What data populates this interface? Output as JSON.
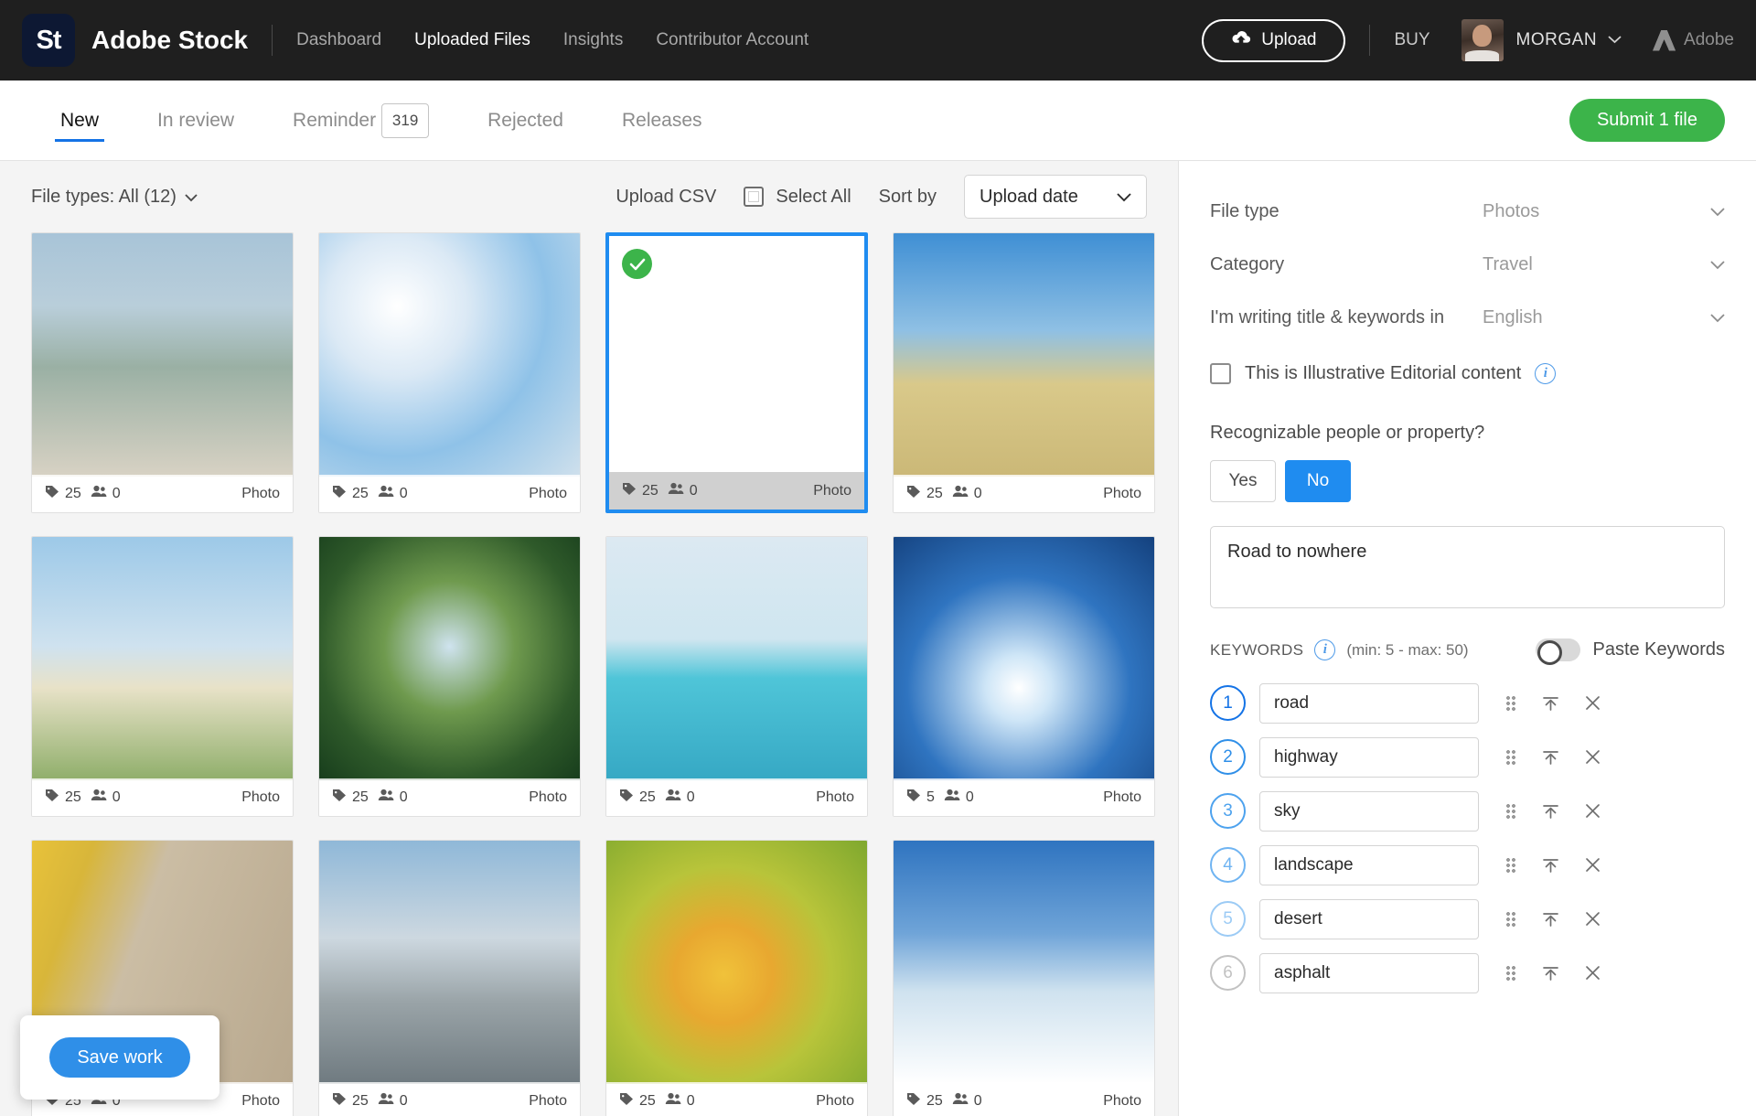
{
  "header": {
    "logo_text": "St",
    "brand": "Adobe Stock",
    "nav": [
      {
        "label": "Dashboard",
        "active": false
      },
      {
        "label": "Uploaded Files",
        "active": true
      },
      {
        "label": "Insights",
        "active": false
      },
      {
        "label": "Contributor Account",
        "active": false
      }
    ],
    "upload_label": "Upload",
    "buy_label": "BUY",
    "user_name": "MORGAN",
    "adobe_label": "Adobe"
  },
  "tabbar": {
    "tabs": [
      {
        "label": "New",
        "active": true,
        "badge": null
      },
      {
        "label": "In review",
        "active": false,
        "badge": null
      },
      {
        "label": "Reminder",
        "active": false,
        "badge": "319"
      },
      {
        "label": "Rejected",
        "active": false,
        "badge": null
      },
      {
        "label": "Releases",
        "active": false,
        "badge": null
      }
    ],
    "submit_label": "Submit 1 file"
  },
  "toolbar": {
    "file_types": "File types: All (12)",
    "upload_csv": "Upload CSV",
    "select_all": "Select All",
    "sort_by_label": "Sort by",
    "sort_value": "Upload date"
  },
  "grid": {
    "save_work_label": "Save work",
    "tiles": [
      {
        "name": "cypress-trees-coast",
        "keywords": "25",
        "releases": "0",
        "type": "Photo",
        "selected": false
      },
      {
        "name": "snowboarder-jump-sun",
        "keywords": "25",
        "releases": "0",
        "type": "Photo",
        "selected": false
      },
      {
        "name": "desert-road-vanishing-point",
        "keywords": "25",
        "releases": "0",
        "type": "Photo",
        "selected": true
      },
      {
        "name": "golden-field-blue-sky",
        "keywords": "25",
        "releases": "0",
        "type": "Photo",
        "selected": false
      },
      {
        "name": "airplane-wing-landing",
        "keywords": "25",
        "releases": "0",
        "type": "Photo",
        "selected": false
      },
      {
        "name": "palm-trees-looking-up",
        "keywords": "25",
        "releases": "0",
        "type": "Photo",
        "selected": false
      },
      {
        "name": "feet-pool-float",
        "keywords": "25",
        "releases": "0",
        "type": "Photo",
        "selected": false
      },
      {
        "name": "skier-sunburst-jump",
        "keywords": "5",
        "releases": "0",
        "type": "Photo",
        "selected": false
      },
      {
        "name": "yellow-vehicle-street",
        "keywords": "25",
        "releases": "0",
        "type": "Photo",
        "selected": false
      },
      {
        "name": "mountain-climber-summit",
        "keywords": "25",
        "releases": "0",
        "type": "Photo",
        "selected": false
      },
      {
        "name": "goldfish-underwater",
        "keywords": "25",
        "releases": "0",
        "type": "Photo",
        "selected": false
      },
      {
        "name": "skier-powder-snow",
        "keywords": "25",
        "releases": "0",
        "type": "Photo",
        "selected": false
      }
    ]
  },
  "panel": {
    "fields": [
      {
        "label": "File type",
        "value": "Photos"
      },
      {
        "label": "Category",
        "value": "Travel"
      },
      {
        "label": "I'm writing title & keywords in",
        "value": "English"
      }
    ],
    "editorial_label": "This is Illustrative Editorial content",
    "recognizable_title": "Recognizable people or property?",
    "yes_label": "Yes",
    "no_label": "No",
    "recognizable_selected": "No",
    "title_value": "Road to nowhere",
    "keywords_label": "KEYWORDS",
    "keywords_range": "(min: 5 - max: 50)",
    "paste_keywords_label": "Paste Keywords",
    "keywords": [
      {
        "index": "1",
        "value": "road"
      },
      {
        "index": "2",
        "value": "highway"
      },
      {
        "index": "3",
        "value": "sky"
      },
      {
        "index": "4",
        "value": "landscape"
      },
      {
        "index": "5",
        "value": "desert"
      },
      {
        "index": "6",
        "value": "asphalt"
      }
    ]
  },
  "colors": {
    "accent_blue": "#1473e6",
    "green": "#3cb44a",
    "header_bg": "#1f1f1f"
  }
}
